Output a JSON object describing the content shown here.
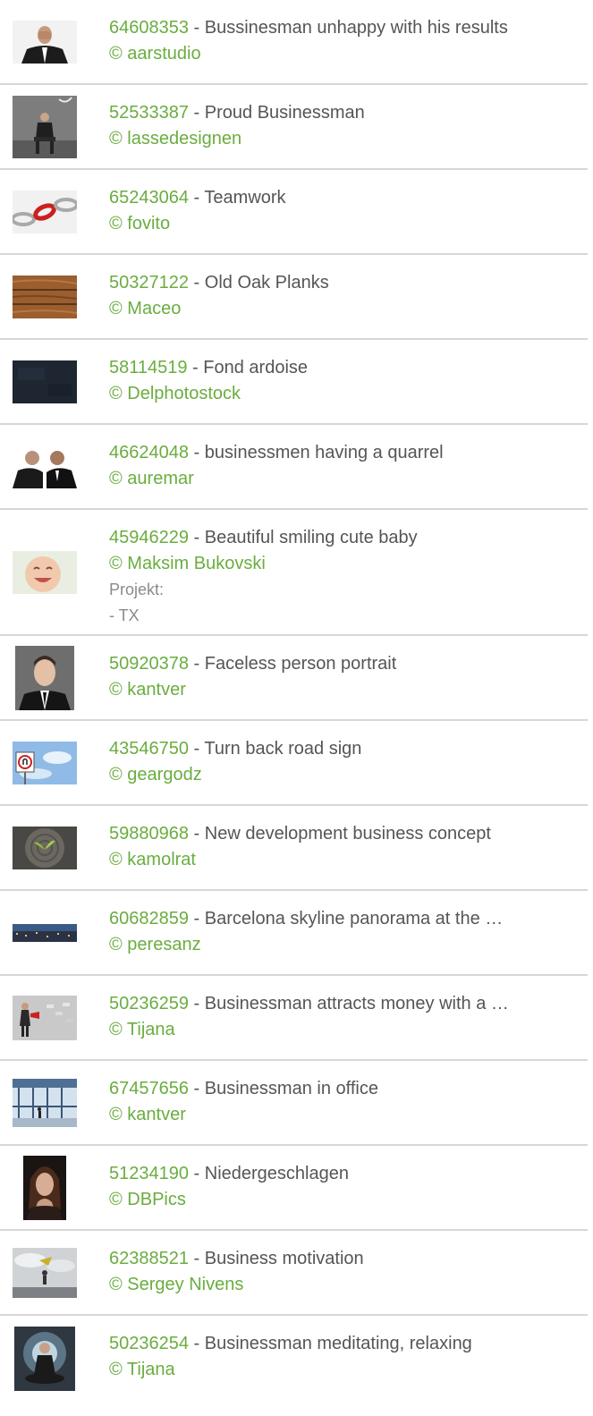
{
  "colors": {
    "id": "#6aad3f",
    "credit": "#6aad3f",
    "title": "#555555",
    "project": "#8a8a8a",
    "divider": "#d6d6d6"
  },
  "items": [
    {
      "id": "64608353",
      "sep": " - ",
      "title": "Bussinesman unhappy with his results",
      "credit": "© aarstudio",
      "thumb": "businessman-facepalm-photo"
    },
    {
      "id": "52533387",
      "sep": " - ",
      "title": "Proud Businessman",
      "credit": "© lassedesignen",
      "thumb": "businessman-sitting-photo"
    },
    {
      "id": "65243064",
      "sep": " - ",
      "title": "Teamwork",
      "credit": "© fovito",
      "thumb": "chain-link-photo"
    },
    {
      "id": "50327122",
      "sep": " - ",
      "title": "Old Oak Planks",
      "credit": "© Maceo",
      "thumb": "wood-planks-photo"
    },
    {
      "id": "58114519",
      "sep": " - ",
      "title": "Fond ardoise",
      "credit": "© Delphotostock",
      "thumb": "slate-texture-photo"
    },
    {
      "id": "46624048",
      "sep": " - ",
      "title": "businessmen having a quarrel",
      "credit": "© auremar",
      "thumb": "businessmen-quarrel-photo"
    },
    {
      "id": "45946229",
      "sep": " - ",
      "title": "Beautiful smiling cute baby",
      "credit": "© Maksim Bukovski",
      "thumb": "smiling-baby-photo",
      "project_label": "Projekt:",
      "project_value": "- TX"
    },
    {
      "id": "50920378",
      "sep": " - ",
      "title": "Faceless person portrait",
      "credit": "© kantver",
      "thumb": "faceless-portrait-photo"
    },
    {
      "id": "43546750",
      "sep": " - ",
      "title": "Turn back road sign",
      "credit": "© geargodz",
      "thumb": "road-sign-photo"
    },
    {
      "id": "59880968",
      "sep": " - ",
      "title": "New development business concept",
      "credit": "© kamolrat",
      "thumb": "sprout-stump-photo"
    },
    {
      "id": "60682859",
      "sep": " - ",
      "title": "Barcelona skyline panorama at the …",
      "credit": "© peresanz",
      "thumb": "city-panorama-photo"
    },
    {
      "id": "50236259",
      "sep": " - ",
      "title": "Businessman attracts money with a …",
      "credit": "© Tijana",
      "thumb": "money-magnet-photo"
    },
    {
      "id": "67457656",
      "sep": " - ",
      "title": "Businessman in office",
      "credit": "© kantver",
      "thumb": "office-window-photo"
    },
    {
      "id": "51234190",
      "sep": " - ",
      "title": "Niedergeschlagen",
      "credit": "© DBPics",
      "thumb": "sad-woman-photo"
    },
    {
      "id": "62388521",
      "sep": " - ",
      "title": "Business motivation",
      "credit": "© Sergey Nivens",
      "thumb": "business-motivation-photo"
    },
    {
      "id": "50236254",
      "sep": " - ",
      "title": "Businessman meditating, relaxing",
      "credit": "© Tijana",
      "thumb": "meditating-businessman-photo"
    }
  ]
}
